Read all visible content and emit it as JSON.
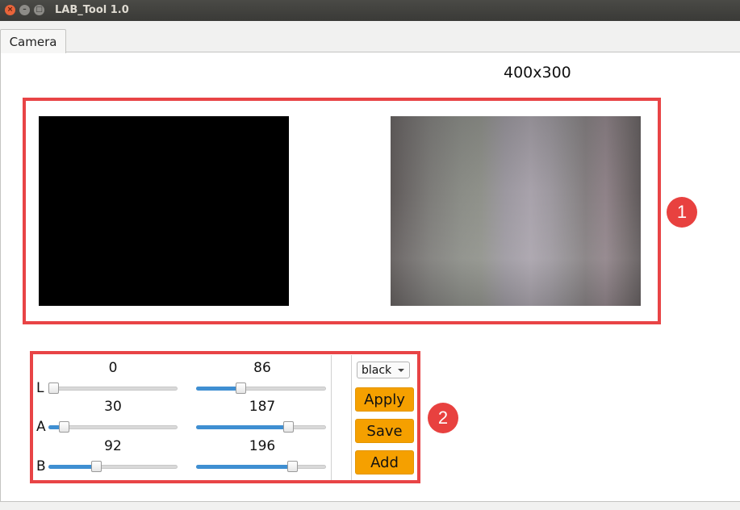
{
  "window": {
    "title": "LAB_Tool 1.0",
    "close_glyph": "×",
    "min_glyph": "–",
    "max_glyph": "□"
  },
  "tabs": [
    {
      "label": "Camera",
      "selected": true
    }
  ],
  "camera": {
    "resolution": "400x300"
  },
  "annotations": {
    "badge1": "1",
    "badge2": "2",
    "color": "#e84446"
  },
  "controls": {
    "rows": [
      {
        "axis": "L",
        "min_value": "0",
        "max_value": "86",
        "min_level": 0.0,
        "max_level": 0.34
      },
      {
        "axis": "A",
        "min_value": "30",
        "max_value": "187",
        "min_level": 0.12,
        "max_level": 0.71
      },
      {
        "axis": "B",
        "min_value": "92",
        "max_value": "196",
        "min_level": 0.37,
        "max_level": 0.74
      }
    ],
    "color_select": {
      "value": "black"
    },
    "buttons": {
      "apply": "Apply",
      "save": "Save",
      "add": "Add"
    },
    "button_color": "#f5a000",
    "slider_fill_color": "#3f8fd2"
  }
}
